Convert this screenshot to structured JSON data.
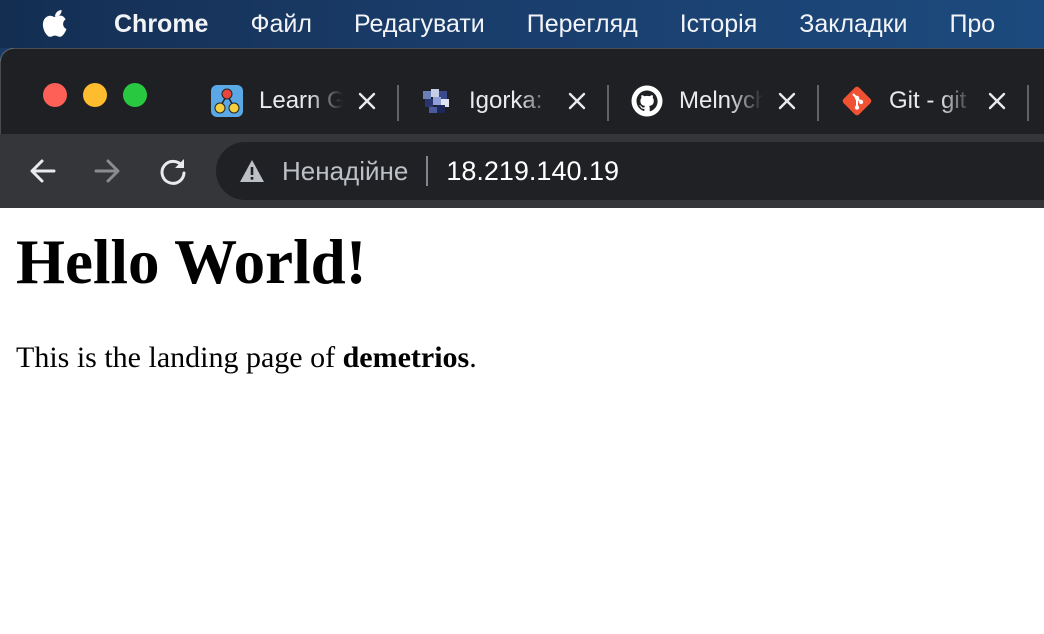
{
  "menubar": {
    "app_name": "Chrome",
    "items": [
      "Файл",
      "Редагувати",
      "Перегляд",
      "Історія",
      "Закладки",
      "Про"
    ]
  },
  "tabs": [
    {
      "title": "Learn Git",
      "favicon": "learn-git-branching-icon"
    },
    {
      "title": "Igorka:",
      "favicon": "pixel-art-icon"
    },
    {
      "title": "Melnych",
      "favicon": "github-icon"
    },
    {
      "title": "Git - git",
      "favicon": "git-logo-icon"
    }
  ],
  "omnibox": {
    "security_label": "Ненадійне",
    "url": "18.219.140.19"
  },
  "page": {
    "heading": "Hello World!",
    "paragraph_prefix": "This is the landing page of ",
    "paragraph_bold": "demetrios",
    "paragraph_suffix": "."
  },
  "colors": {
    "tabstrip_bg": "#1f2023",
    "toolbar_bg": "#35363a",
    "omnibox_bg": "#202124",
    "traffic_red": "#fe5f57",
    "traffic_yellow": "#febc2e",
    "traffic_green": "#28c840"
  }
}
